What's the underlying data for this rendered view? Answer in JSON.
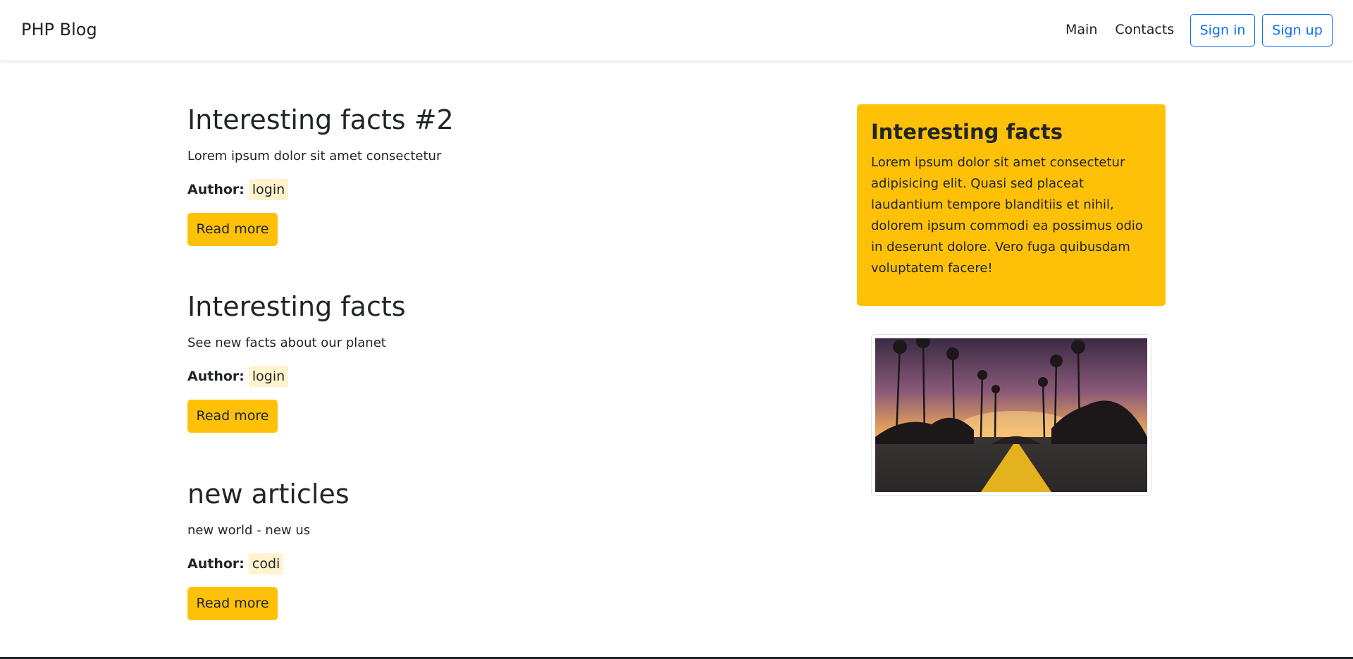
{
  "navbar": {
    "brand": "PHP Blog",
    "links": [
      "Main",
      "Contacts"
    ],
    "sign_in": "Sign in",
    "sign_up": "Sign up"
  },
  "posts": [
    {
      "title": "Interesting facts #2",
      "description": "Lorem ipsum dolor sit amet consectetur",
      "author_label": "Author:",
      "author": "login",
      "button": "Read more"
    },
    {
      "title": "Interesting facts",
      "description": "See new facts about our planet",
      "author_label": "Author:",
      "author": "login",
      "button": "Read more"
    },
    {
      "title": "new articles",
      "description": "new world - new us",
      "author_label": "Author:",
      "author": "codi",
      "button": "Read more"
    }
  ],
  "sidebar": {
    "title": "Interesting facts",
    "text": "Lorem ipsum dolor sit amet consectetur adipisicing elit. Quasi sed placeat laudantium tempore blanditiis et nihil, dolorem ipsum commodi ea possimus odio in deserunt dolore. Vero fuga quibusdam voluptatem facere!"
  },
  "colors": {
    "accent": "#ffc107",
    "primary": "#0d6efd",
    "author_bg": "#fff3cd"
  }
}
